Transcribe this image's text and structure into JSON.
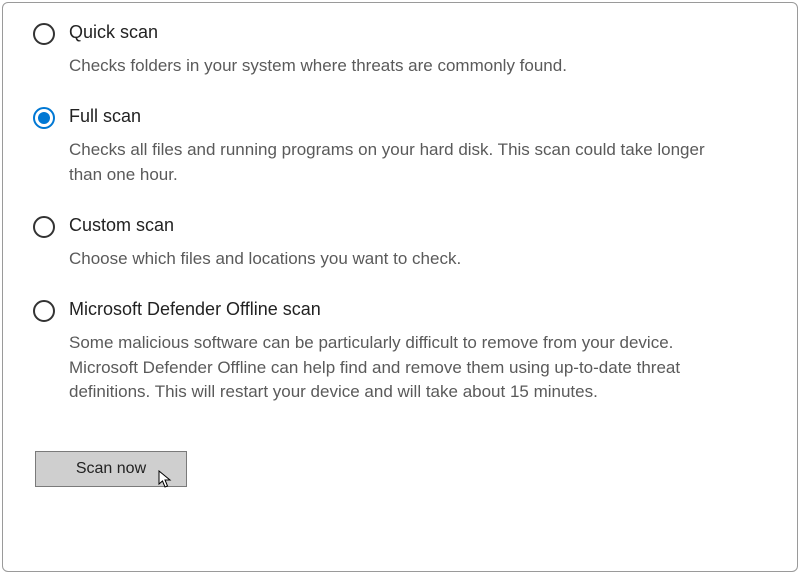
{
  "options": {
    "quick": {
      "label": "Quick scan",
      "desc": "Checks folders in your system where threats are commonly found.",
      "selected": false
    },
    "full": {
      "label": "Full scan",
      "desc": "Checks all files and running programs on your hard disk. This scan could take longer than one hour.",
      "selected": true
    },
    "custom": {
      "label": "Custom scan",
      "desc": "Choose which files and locations you want to check.",
      "selected": false
    },
    "offline": {
      "label": "Microsoft Defender Offline scan",
      "desc": "Some malicious software can be particularly difficult to remove from your device. Microsoft Defender Offline can help find and remove them using up-to-date threat definitions. This will restart your device and will take about 15 minutes.",
      "selected": false
    }
  },
  "button": {
    "scan_now": "Scan now"
  },
  "colors": {
    "accent": "#0078d4"
  }
}
